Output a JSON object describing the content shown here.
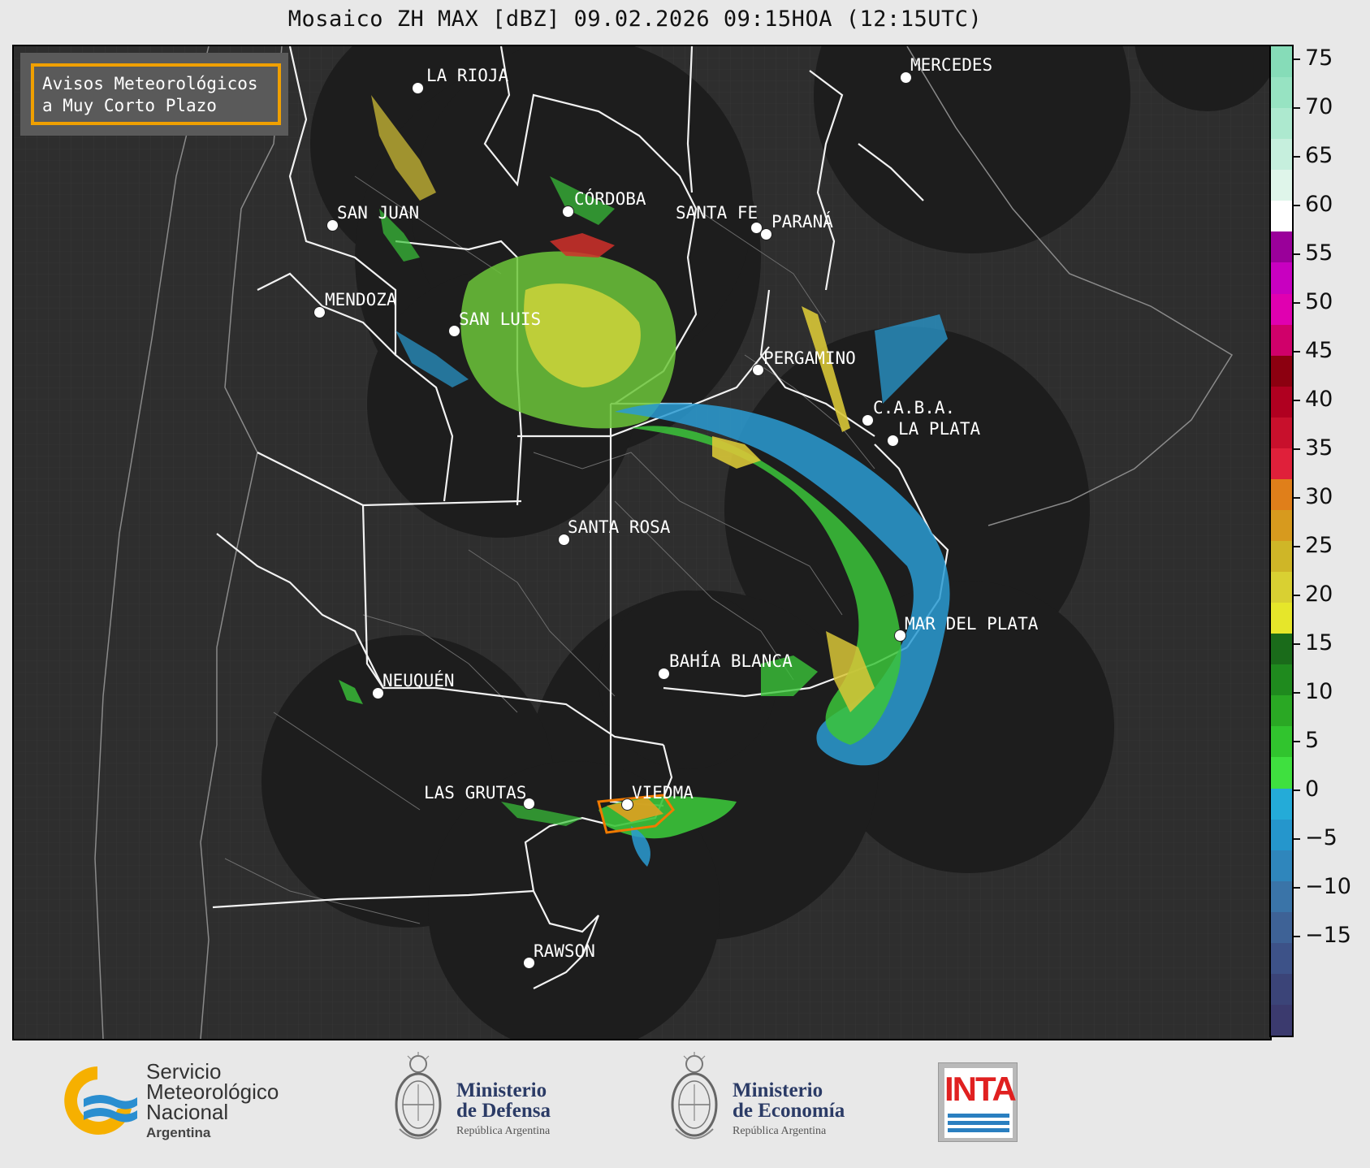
{
  "title": "Mosaico ZH MAX [dBZ] 09.02.2026 09:15HOA (12:15UTC)",
  "notice": {
    "line1": "Avisos Meteorológicos",
    "line2": "a Muy Corto Plazo"
  },
  "cities": [
    {
      "name": "LA RIOJA"
    },
    {
      "name": "SAN JUAN"
    },
    {
      "name": "CÓRDOBA"
    },
    {
      "name": "SANTA FE"
    },
    {
      "name": "PARANÁ"
    },
    {
      "name": "MENDOZA"
    },
    {
      "name": "SAN LUIS"
    },
    {
      "name": "PERGAMINO"
    },
    {
      "name": "C.A.B.A."
    },
    {
      "name": "LA PLATA"
    },
    {
      "name": "MERCEDES"
    },
    {
      "name": "SANTA ROSA"
    },
    {
      "name": "MAR DEL PLATA"
    },
    {
      "name": "BAHÍA BLANCA"
    },
    {
      "name": "NEUQUÉN"
    },
    {
      "name": "LAS GRUTAS"
    },
    {
      "name": "VIEDMA"
    },
    {
      "name": "RAWSON"
    }
  ],
  "colorbar": {
    "unit": "dBZ",
    "ticks": [
      "75",
      "70",
      "65",
      "60",
      "55",
      "50",
      "45",
      "40",
      "35",
      "30",
      "25",
      "20",
      "15",
      "10",
      "5",
      "0",
      "−5",
      "−10",
      "−15"
    ],
    "colors": [
      "#3b3a6e",
      "#3b4478",
      "#3d5288",
      "#3e6296",
      "#3a74a8",
      "#2f86bc",
      "#2596cc",
      "#24abd8",
      "#3fe03f",
      "#31c42e",
      "#2aa824",
      "#1f8a1e",
      "#1a6b1a",
      "#e6e62a",
      "#d9d032",
      "#cfb627",
      "#d79a1e",
      "#e07f1a",
      "#e0203a",
      "#c8102c",
      "#b00020",
      "#8c0010",
      "#d0006a",
      "#e000b0",
      "#c800c0",
      "#9a009a",
      "#ffffff",
      "#dff5ea",
      "#c6efdd",
      "#ade9cf",
      "#97e3c2",
      "#86dcb8"
    ]
  },
  "footer": {
    "smn": {
      "line1": "Servicio",
      "line2": "Meteorológico",
      "line3": "Nacional",
      "line4": "Argentina"
    },
    "defensa": {
      "line1": "Ministerio",
      "line2": "de Defensa",
      "line3": "República Argentina"
    },
    "economia": {
      "line1": "Ministerio",
      "line2": "de Economía",
      "line3": "República Argentina"
    },
    "inta": {
      "text": "INTA"
    }
  }
}
